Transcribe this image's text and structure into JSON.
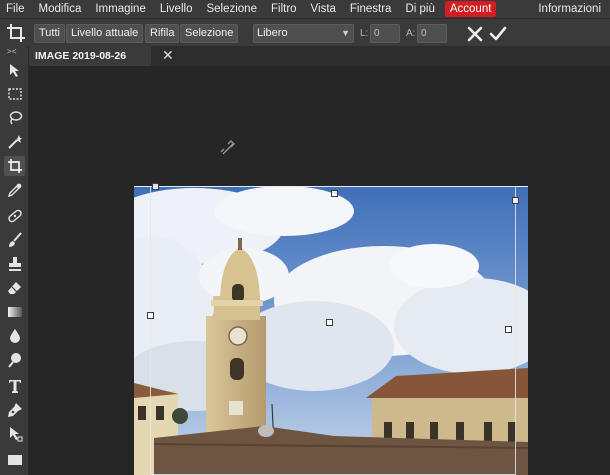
{
  "menu": {
    "items": [
      "File",
      "Modifica",
      "Immagine",
      "Livello",
      "Selezione",
      "Filtro",
      "Vista",
      "Finestra",
      "Di più"
    ],
    "account": "Account",
    "info": "Informazioni"
  },
  "options": {
    "buttons": [
      "Tutti",
      "Livello attuale",
      "Rifila",
      "Selezione"
    ],
    "ratio_value": "Libero",
    "width_label": "L:",
    "width_value": "0",
    "height_label": "A:",
    "height_value": "0"
  },
  "toolbox": {
    "collapse": "> <",
    "tools": [
      "move-tool",
      "marquee-tool",
      "lasso-tool",
      "magic-wand-tool",
      "crop-tool",
      "eyedropper-tool",
      "spot-heal-tool",
      "brush-tool",
      "stamp-tool",
      "eraser-tool",
      "gradient-tool",
      "blur-tool",
      "dodge-tool",
      "text-tool",
      "pen-tool",
      "path-select-tool",
      "shape-tool"
    ],
    "active_tool": "crop-tool"
  },
  "document": {
    "tab_title": "IMAGE 2019-08-26",
    "close_symbol": "✕"
  },
  "colors": {
    "menu_bg": "#3a3a3a",
    "workspace_bg": "#262626",
    "account_red": "#d01f22",
    "sky": "#4f7fc4"
  }
}
